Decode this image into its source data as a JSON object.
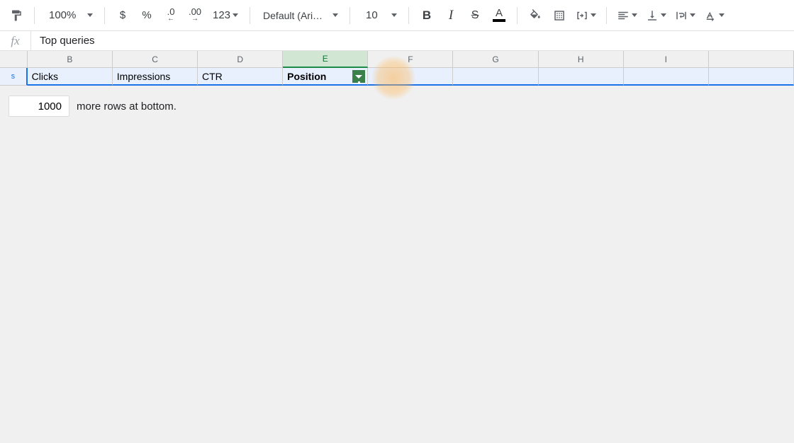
{
  "toolbar": {
    "zoom": "100%",
    "font_name": "Default (Ari…",
    "font_size": "10",
    "number_format": {
      "currency": "$",
      "percent": "%",
      "dec_decrease": ".0",
      "dec_increase": ".00",
      "more": "123"
    }
  },
  "formula_bar": {
    "fx": "fx",
    "value": "Top queries"
  },
  "columns": [
    "B",
    "C",
    "D",
    "E",
    "F",
    "G",
    "H",
    "I"
  ],
  "selected_column": "E",
  "row1_header": "s",
  "row1": {
    "B": "Clicks",
    "C": "Impressions",
    "D": "CTR",
    "E": "Position",
    "F": "",
    "G": "",
    "H": "",
    "I": ""
  },
  "add_rows": {
    "value": "1000",
    "label": "more rows at bottom."
  }
}
